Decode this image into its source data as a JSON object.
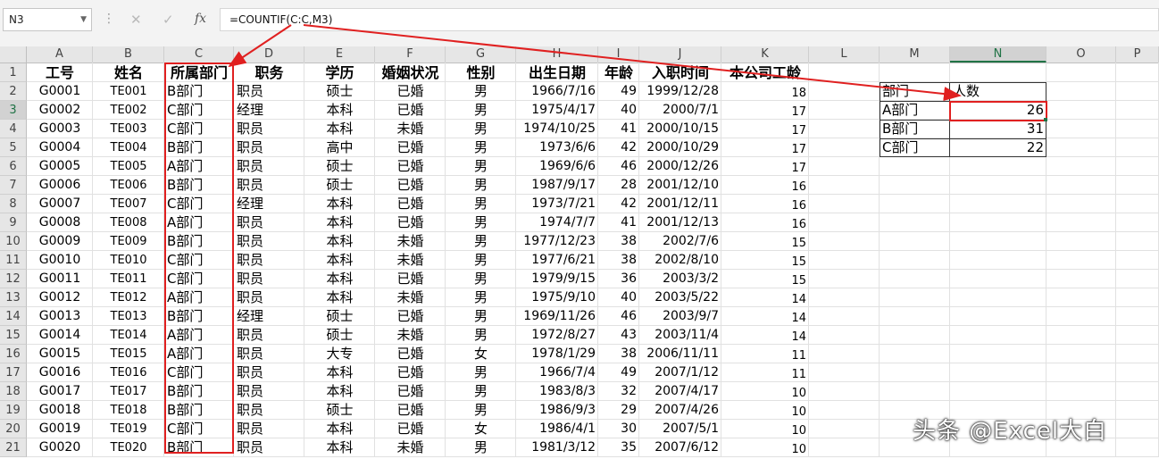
{
  "formula_bar": {
    "name_box": "N3",
    "formula": "=COUNTIF(C:C,M3)",
    "cancel_glyph": "✕",
    "enter_glyph": "✓",
    "fx_glyph": "fx",
    "dots": "⋮"
  },
  "columns": [
    "A",
    "B",
    "C",
    "D",
    "E",
    "F",
    "G",
    "H",
    "I",
    "J",
    "K",
    "L",
    "M",
    "N",
    "O",
    "P"
  ],
  "selected_column": "N",
  "selected_row": "3",
  "headers": {
    "A": "工号",
    "B": "姓名",
    "C": "所属部门",
    "D": "职务",
    "E": "学历",
    "F": "婚姻状况",
    "G": "性别",
    "H": "出生日期",
    "I": "年龄",
    "J": "入职时间",
    "K": "本公司工龄"
  },
  "rows": [
    [
      "G0001",
      "TE001",
      "B部门",
      "职员",
      "硕士",
      "已婚",
      "男",
      "1966/7/16",
      "49",
      "1999/12/28",
      "18"
    ],
    [
      "G0002",
      "TE002",
      "C部门",
      "经理",
      "本科",
      "已婚",
      "男",
      "1975/4/17",
      "40",
      "2000/7/1",
      "17"
    ],
    [
      "G0003",
      "TE003",
      "C部门",
      "职员",
      "本科",
      "未婚",
      "男",
      "1974/10/25",
      "41",
      "2000/10/15",
      "17"
    ],
    [
      "G0004",
      "TE004",
      "B部门",
      "职员",
      "高中",
      "已婚",
      "男",
      "1973/6/6",
      "42",
      "2000/10/29",
      "17"
    ],
    [
      "G0005",
      "TE005",
      "A部门",
      "职员",
      "硕士",
      "已婚",
      "男",
      "1969/6/6",
      "46",
      "2000/12/26",
      "17"
    ],
    [
      "G0006",
      "TE006",
      "B部门",
      "职员",
      "硕士",
      "已婚",
      "男",
      "1987/9/17",
      "28",
      "2001/12/10",
      "16"
    ],
    [
      "G0007",
      "TE007",
      "C部门",
      "经理",
      "本科",
      "已婚",
      "男",
      "1973/7/21",
      "42",
      "2001/12/11",
      "16"
    ],
    [
      "G0008",
      "TE008",
      "A部门",
      "职员",
      "本科",
      "已婚",
      "男",
      "1974/7/7",
      "41",
      "2001/12/13",
      "16"
    ],
    [
      "G0009",
      "TE009",
      "B部门",
      "职员",
      "本科",
      "未婚",
      "男",
      "1977/12/23",
      "38",
      "2002/7/6",
      "15"
    ],
    [
      "G0010",
      "TE010",
      "C部门",
      "职员",
      "本科",
      "未婚",
      "男",
      "1977/6/21",
      "38",
      "2002/8/10",
      "15"
    ],
    [
      "G0011",
      "TE011",
      "C部门",
      "职员",
      "本科",
      "已婚",
      "男",
      "1979/9/15",
      "36",
      "2003/3/2",
      "15"
    ],
    [
      "G0012",
      "TE012",
      "A部门",
      "职员",
      "本科",
      "未婚",
      "男",
      "1975/9/10",
      "40",
      "2003/5/22",
      "14"
    ],
    [
      "G0013",
      "TE013",
      "B部门",
      "经理",
      "硕士",
      "已婚",
      "男",
      "1969/11/26",
      "46",
      "2003/9/7",
      "14"
    ],
    [
      "G0014",
      "TE014",
      "A部门",
      "职员",
      "硕士",
      "未婚",
      "男",
      "1972/8/27",
      "43",
      "2003/11/4",
      "14"
    ],
    [
      "G0015",
      "TE015",
      "A部门",
      "职员",
      "大专",
      "已婚",
      "女",
      "1978/1/29",
      "38",
      "2006/11/11",
      "11"
    ],
    [
      "G0016",
      "TE016",
      "C部门",
      "职员",
      "本科",
      "已婚",
      "男",
      "1966/7/4",
      "49",
      "2007/1/12",
      "11"
    ],
    [
      "G0017",
      "TE017",
      "B部门",
      "职员",
      "本科",
      "已婚",
      "男",
      "1983/8/3",
      "32",
      "2007/4/17",
      "10"
    ],
    [
      "G0018",
      "TE018",
      "B部门",
      "职员",
      "硕士",
      "已婚",
      "男",
      "1986/9/3",
      "29",
      "2007/4/26",
      "10"
    ],
    [
      "G0019",
      "TE019",
      "C部门",
      "职员",
      "本科",
      "已婚",
      "女",
      "1986/4/1",
      "30",
      "2007/5/1",
      "10"
    ],
    [
      "G0020",
      "TE020",
      "B部门",
      "职员",
      "本科",
      "未婚",
      "男",
      "1981/3/12",
      "35",
      "2007/6/12",
      "10"
    ]
  ],
  "summary": {
    "header_label": "部门",
    "header_count": "人数",
    "items": [
      {
        "dept": "A部门",
        "count": "26"
      },
      {
        "dept": "B部门",
        "count": "31"
      },
      {
        "dept": "C部门",
        "count": "22"
      }
    ]
  },
  "watermark": "头条 @Excel大白",
  "colors": {
    "annotation": "#e02020",
    "selection": "#217346"
  }
}
